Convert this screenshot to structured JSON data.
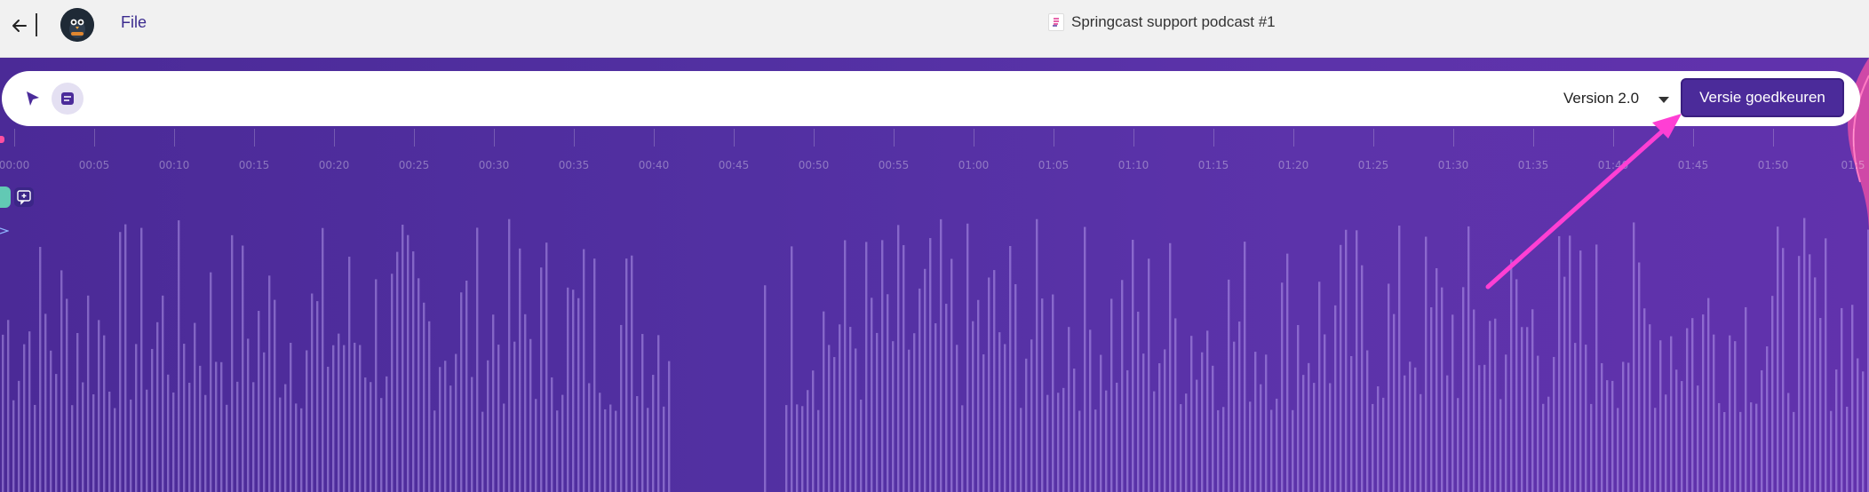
{
  "header": {
    "file_label": "File",
    "doc_title": "Springcast support podcast #1",
    "back_icon": "arrow-left-icon",
    "avatar_icon": "bird-avatar-icon"
  },
  "toolbar": {
    "pointer_icon": "cursor-pointer-icon",
    "caption_icon": "caption-icon",
    "version_label": "Version 2.0",
    "approve_label": "Versie goedkeuren"
  },
  "timeline": {
    "labels": [
      "00:00",
      "00:05",
      "00:10",
      "00:15",
      "00:20",
      "00:25",
      "00:30",
      "00:35",
      "00:40",
      "00:45",
      "00:50",
      "00:55",
      "01:00",
      "01:05",
      "01:10",
      "01:15",
      "01:20",
      "01:25",
      "01:30",
      "01:35",
      "01:40",
      "01:45",
      "01:50",
      "01:5"
    ]
  },
  "colors": {
    "accent": "#4b2b9a",
    "annotation_arrow": "#ff3fd4",
    "playhead": "#ff4fa0",
    "marker": "#62c9b4"
  }
}
